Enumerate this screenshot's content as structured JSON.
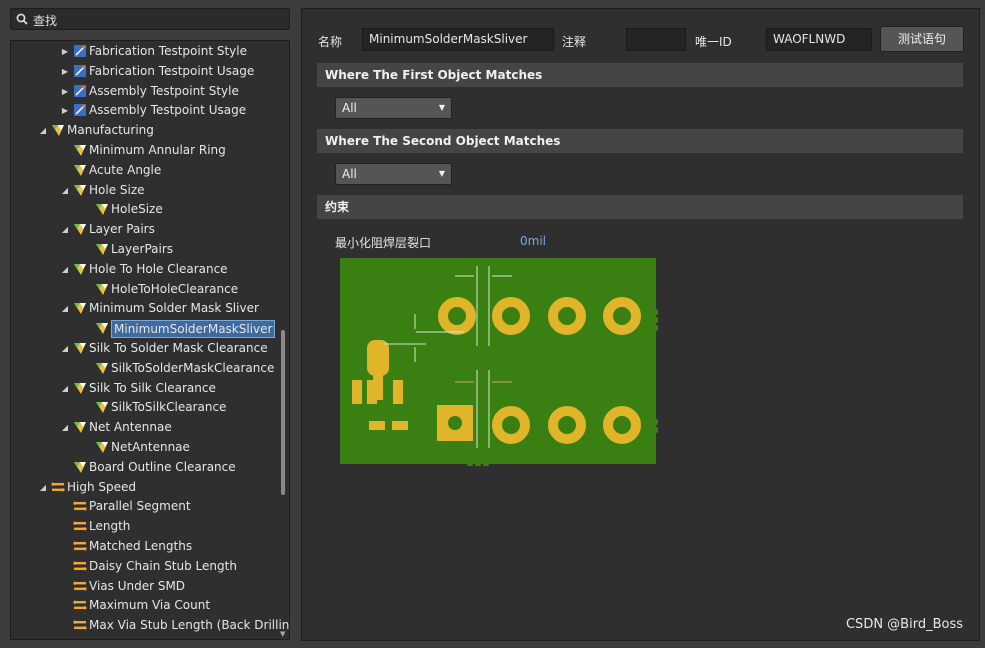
{
  "search": {
    "label": "查找"
  },
  "tree": [
    {
      "label": "Fabrication Testpoint Style",
      "indent": 1,
      "arrow": "right",
      "icon": "testpoint-icon"
    },
    {
      "label": "Fabrication Testpoint Usage",
      "indent": 1,
      "arrow": "right",
      "icon": "testpoint-icon"
    },
    {
      "label": "Assembly Testpoint Style",
      "indent": 1,
      "arrow": "right",
      "icon": "testpoint-icon"
    },
    {
      "label": "Assembly Testpoint Usage",
      "indent": 1,
      "arrow": "right",
      "icon": "testpoint-icon"
    },
    {
      "label": "Manufacturing",
      "indent": 0,
      "arrow": "down",
      "icon": "manufacturing-icon"
    },
    {
      "label": "Minimum Annular Ring",
      "indent": 1,
      "arrow": "",
      "icon": "manufacturing-icon"
    },
    {
      "label": "Acute Angle",
      "indent": 1,
      "arrow": "",
      "icon": "manufacturing-icon"
    },
    {
      "label": "Hole Size",
      "indent": 1,
      "arrow": "down",
      "icon": "manufacturing-icon"
    },
    {
      "label": "HoleSize",
      "indent": 2,
      "arrow": "",
      "icon": "manufacturing-icon"
    },
    {
      "label": "Layer Pairs",
      "indent": 1,
      "arrow": "down",
      "icon": "manufacturing-icon"
    },
    {
      "label": "LayerPairs",
      "indent": 2,
      "arrow": "",
      "icon": "manufacturing-icon"
    },
    {
      "label": "Hole To Hole Clearance",
      "indent": 1,
      "arrow": "down",
      "icon": "manufacturing-icon"
    },
    {
      "label": "HoleToHoleClearance",
      "indent": 2,
      "arrow": "",
      "icon": "manufacturing-icon"
    },
    {
      "label": "Minimum Solder Mask Sliver",
      "indent": 1,
      "arrow": "down",
      "icon": "manufacturing-icon"
    },
    {
      "label": "MinimumSolderMaskSliver",
      "indent": 2,
      "arrow": "",
      "icon": "manufacturing-icon",
      "selected": true
    },
    {
      "label": "Silk To Solder Mask Clearance",
      "indent": 1,
      "arrow": "down",
      "icon": "manufacturing-icon"
    },
    {
      "label": "SilkToSolderMaskClearance",
      "indent": 2,
      "arrow": "",
      "icon": "manufacturing-icon"
    },
    {
      "label": "Silk To Silk Clearance",
      "indent": 1,
      "arrow": "down",
      "icon": "manufacturing-icon"
    },
    {
      "label": "SilkToSilkClearance",
      "indent": 2,
      "arrow": "",
      "icon": "manufacturing-icon"
    },
    {
      "label": "Net Antennae",
      "indent": 1,
      "arrow": "down",
      "icon": "manufacturing-icon"
    },
    {
      "label": "NetAntennae",
      "indent": 2,
      "arrow": "",
      "icon": "manufacturing-icon"
    },
    {
      "label": "Board Outline Clearance",
      "indent": 1,
      "arrow": "",
      "icon": "manufacturing-icon"
    },
    {
      "label": "High Speed",
      "indent": 0,
      "arrow": "down",
      "icon": "high-speed-icon"
    },
    {
      "label": "Parallel Segment",
      "indent": 1,
      "arrow": "",
      "icon": "high-speed-icon"
    },
    {
      "label": "Length",
      "indent": 1,
      "arrow": "",
      "icon": "high-speed-icon"
    },
    {
      "label": "Matched Lengths",
      "indent": 1,
      "arrow": "",
      "icon": "high-speed-icon"
    },
    {
      "label": "Daisy Chain Stub Length",
      "indent": 1,
      "arrow": "",
      "icon": "high-speed-icon"
    },
    {
      "label": "Vias Under SMD",
      "indent": 1,
      "arrow": "",
      "icon": "high-speed-icon"
    },
    {
      "label": "Maximum Via Count",
      "indent": 1,
      "arrow": "",
      "icon": "high-speed-icon"
    },
    {
      "label": "Max Via Stub Length (Back Drilling",
      "indent": 1,
      "arrow": "",
      "icon": "high-speed-icon"
    }
  ],
  "form": {
    "name_label": "名称",
    "name_value": "MinimumSolderMaskSliver",
    "comment_label": "注释",
    "comment_value": "",
    "uid_label": "唯一ID",
    "uid_value": "WAOFLNWD",
    "test_button": "测试语句"
  },
  "sections": {
    "first": "Where The First Object Matches",
    "second": "Where The Second Object Matches",
    "constraint": "约束"
  },
  "first_select": "All",
  "second_select": "All",
  "constraint": {
    "label": "最小化阻焊层裂口",
    "value": "0mil"
  },
  "colors": {
    "board": "#3a7f12",
    "pad": "#e0b52a",
    "selection": "#3e6a9e"
  },
  "watermark": "CSDN @Bird_Boss"
}
